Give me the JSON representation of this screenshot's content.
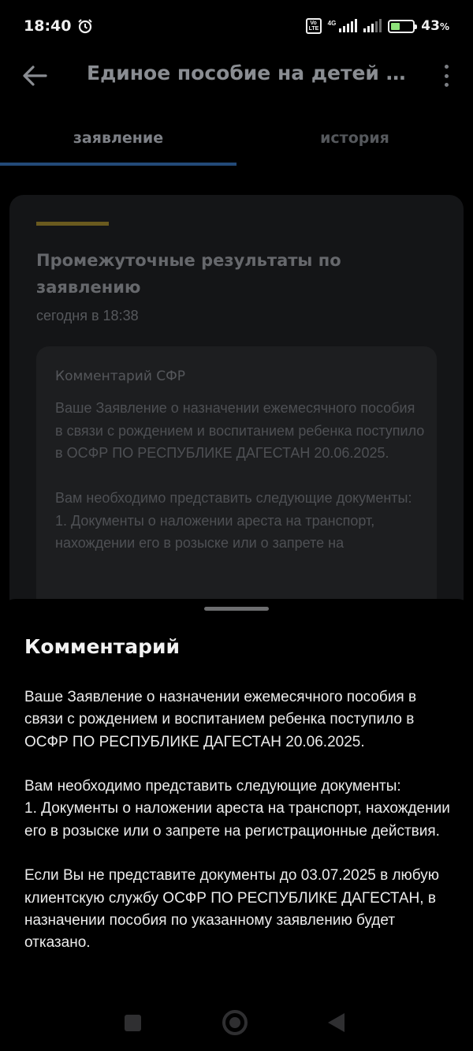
{
  "status_bar": {
    "time": "18:40",
    "volte_label": "Vo LTE",
    "network_type": "4G",
    "battery_percent": "43",
    "battery_unit": "%",
    "battery_level": 0.43,
    "icons": [
      "alarm-icon",
      "volte-icon",
      "signal-icon",
      "signal-icon",
      "battery-charging-icon"
    ]
  },
  "app_bar": {
    "title": "Единое пособие на детей и б...",
    "back_icon": "arrow-left-icon",
    "menu_icon": "more-vertical-icon"
  },
  "tabs": [
    {
      "label": "заявление",
      "active": true
    },
    {
      "label": "история",
      "active": false
    }
  ],
  "card": {
    "title": "Промежуточные результаты по заявлению",
    "date": "сегодня в 18:38",
    "comment_label": "Комментарий СФР",
    "comment_text": "Ваше Заявление о назначении ежемесячного пособия в связи с рождением и воспитанием ребенка поступило в ОСФР ПО РЕСПУБЛИКЕ ДАГЕСТАН 20.06.2025.\n\nВам необходимо представить следующие документы:\n1. Документы о наложении ареста на транспорт, нахождении его в розыске или о запрете на"
  },
  "sheet": {
    "title": "Комментарий",
    "text": "Ваше Заявление о назначении ежемесячного пособия в связи с рождением и воспитанием ребенка поступило в ОСФР ПО РЕСПУБЛИКЕ ДАГЕСТАН 20.06.2025.\n\nВам необходимо представить следующие документы:\n1. Документы о наложении ареста на транспорт, нахождении его в розыске или о запрете на регистрационные действия.\n\nЕсли Вы не представите документы до 03.07.2025 в любую клиентскую службу ОСФР ПО РЕСПУБЛИКЕ ДАГЕСТАН, в назначении пособия по указанному заявлению будет отказано."
  },
  "colors": {
    "background": "#000000",
    "tab_indicator": "#234a78",
    "card_accent": "#6a5a1f",
    "battery_charge": "#8ee27a"
  }
}
